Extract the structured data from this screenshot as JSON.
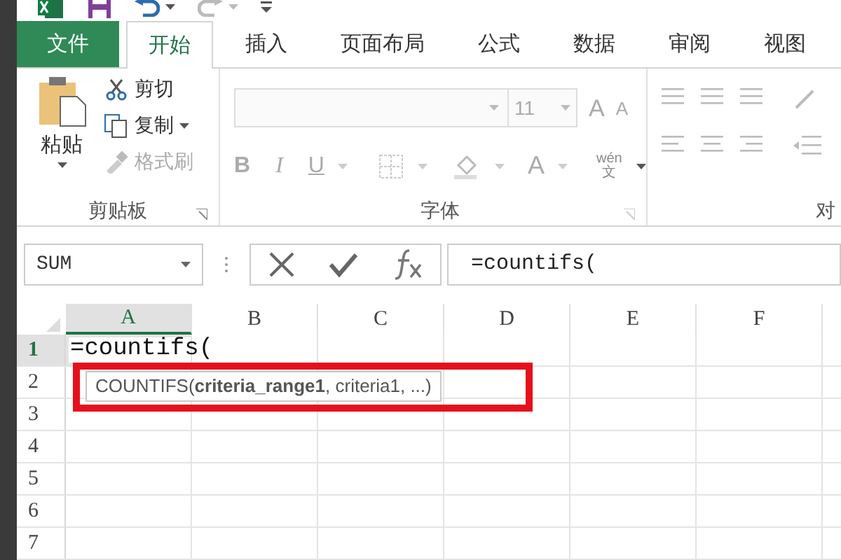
{
  "tabs": [
    {
      "label": "文件",
      "kind": "file",
      "selected": false
    },
    {
      "label": "开始",
      "kind": "tab",
      "selected": true
    },
    {
      "label": "插入",
      "kind": "tab",
      "selected": false
    },
    {
      "label": "页面布局",
      "kind": "tab",
      "selected": false
    },
    {
      "label": "公式",
      "kind": "tab",
      "selected": false
    },
    {
      "label": "数据",
      "kind": "tab",
      "selected": false
    },
    {
      "label": "审阅",
      "kind": "tab",
      "selected": false
    },
    {
      "label": "视图",
      "kind": "tab",
      "selected": false
    }
  ],
  "clipboard": {
    "paste": "粘贴",
    "cut": "剪切",
    "copy": "复制",
    "format_painter": "格式刷",
    "group_label": "剪贴板"
  },
  "font": {
    "font_size": "11",
    "grow": "A",
    "shrink": "A",
    "bold": "B",
    "italic": "I",
    "underline": "U",
    "font_color": "A",
    "phonetic_top": "wén",
    "phonetic_bottom": "文",
    "group_label": "字体"
  },
  "alignment": {
    "group_label": "对"
  },
  "formula_bar": {
    "name_box": "SUM",
    "formula": "=countifs("
  },
  "columns": [
    {
      "label": "A",
      "selected": true
    },
    {
      "label": "B",
      "selected": false
    },
    {
      "label": "C",
      "selected": false
    },
    {
      "label": "D",
      "selected": false
    },
    {
      "label": "E",
      "selected": false
    },
    {
      "label": "F",
      "selected": false
    }
  ],
  "rows": [
    {
      "label": "1",
      "selected": true,
      "cell_a": "=countifs("
    },
    {
      "label": "2",
      "selected": false
    },
    {
      "label": "3",
      "selected": false
    },
    {
      "label": "4",
      "selected": false
    },
    {
      "label": "5",
      "selected": false
    },
    {
      "label": "6",
      "selected": false
    },
    {
      "label": "7",
      "selected": false
    }
  ],
  "tooltip": "COUNTIFS(**criteria_range1**, criteria1, ...)"
}
